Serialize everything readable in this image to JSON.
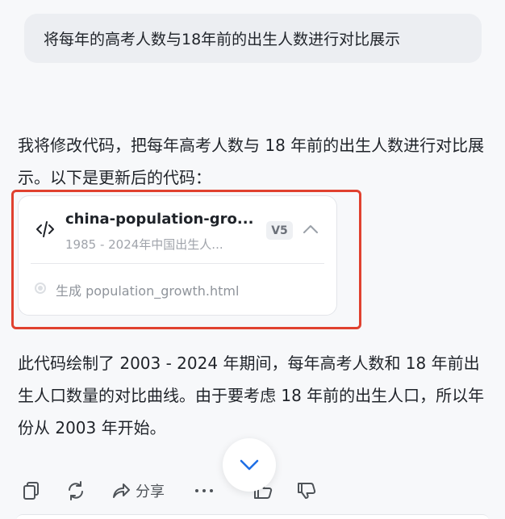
{
  "user_message": "将每年的高考人数与18年前的出生人数进行对比展示",
  "assistant": {
    "intro_text": "我将修改代码，把每年高考人数与 18 年前的出生人数进行对比展示。以下是更新后的代码：",
    "summary_text": "此代码绘制了 2003 - 2024 年期间，每年高考人数和 18 年前出生人口数量的对比曲线。由于要考虑 18 年前的出生人口，所以年份从 2003 年开始。"
  },
  "code_card": {
    "icon": "code-icon",
    "file_name": "china-population-gro...",
    "description": "1985 - 2024年中国出生人...",
    "version": "V5",
    "collapse_icon": "chevron-up-icon",
    "step_label": "生成 population_growth.html"
  },
  "toolbar": {
    "copy_icon": "copy-icon",
    "regenerate_icon": "refresh-icon",
    "share_icon": "share-icon",
    "share_label": "分享",
    "more_icon": "more-icon",
    "like_icon": "thumbs-up-icon",
    "dislike_icon": "thumbs-down-icon"
  },
  "scroll_down_icon": "chevron-down-icon",
  "colors": {
    "highlight_border": "#e0412f",
    "scroll_arrow": "#1f6fe5"
  }
}
